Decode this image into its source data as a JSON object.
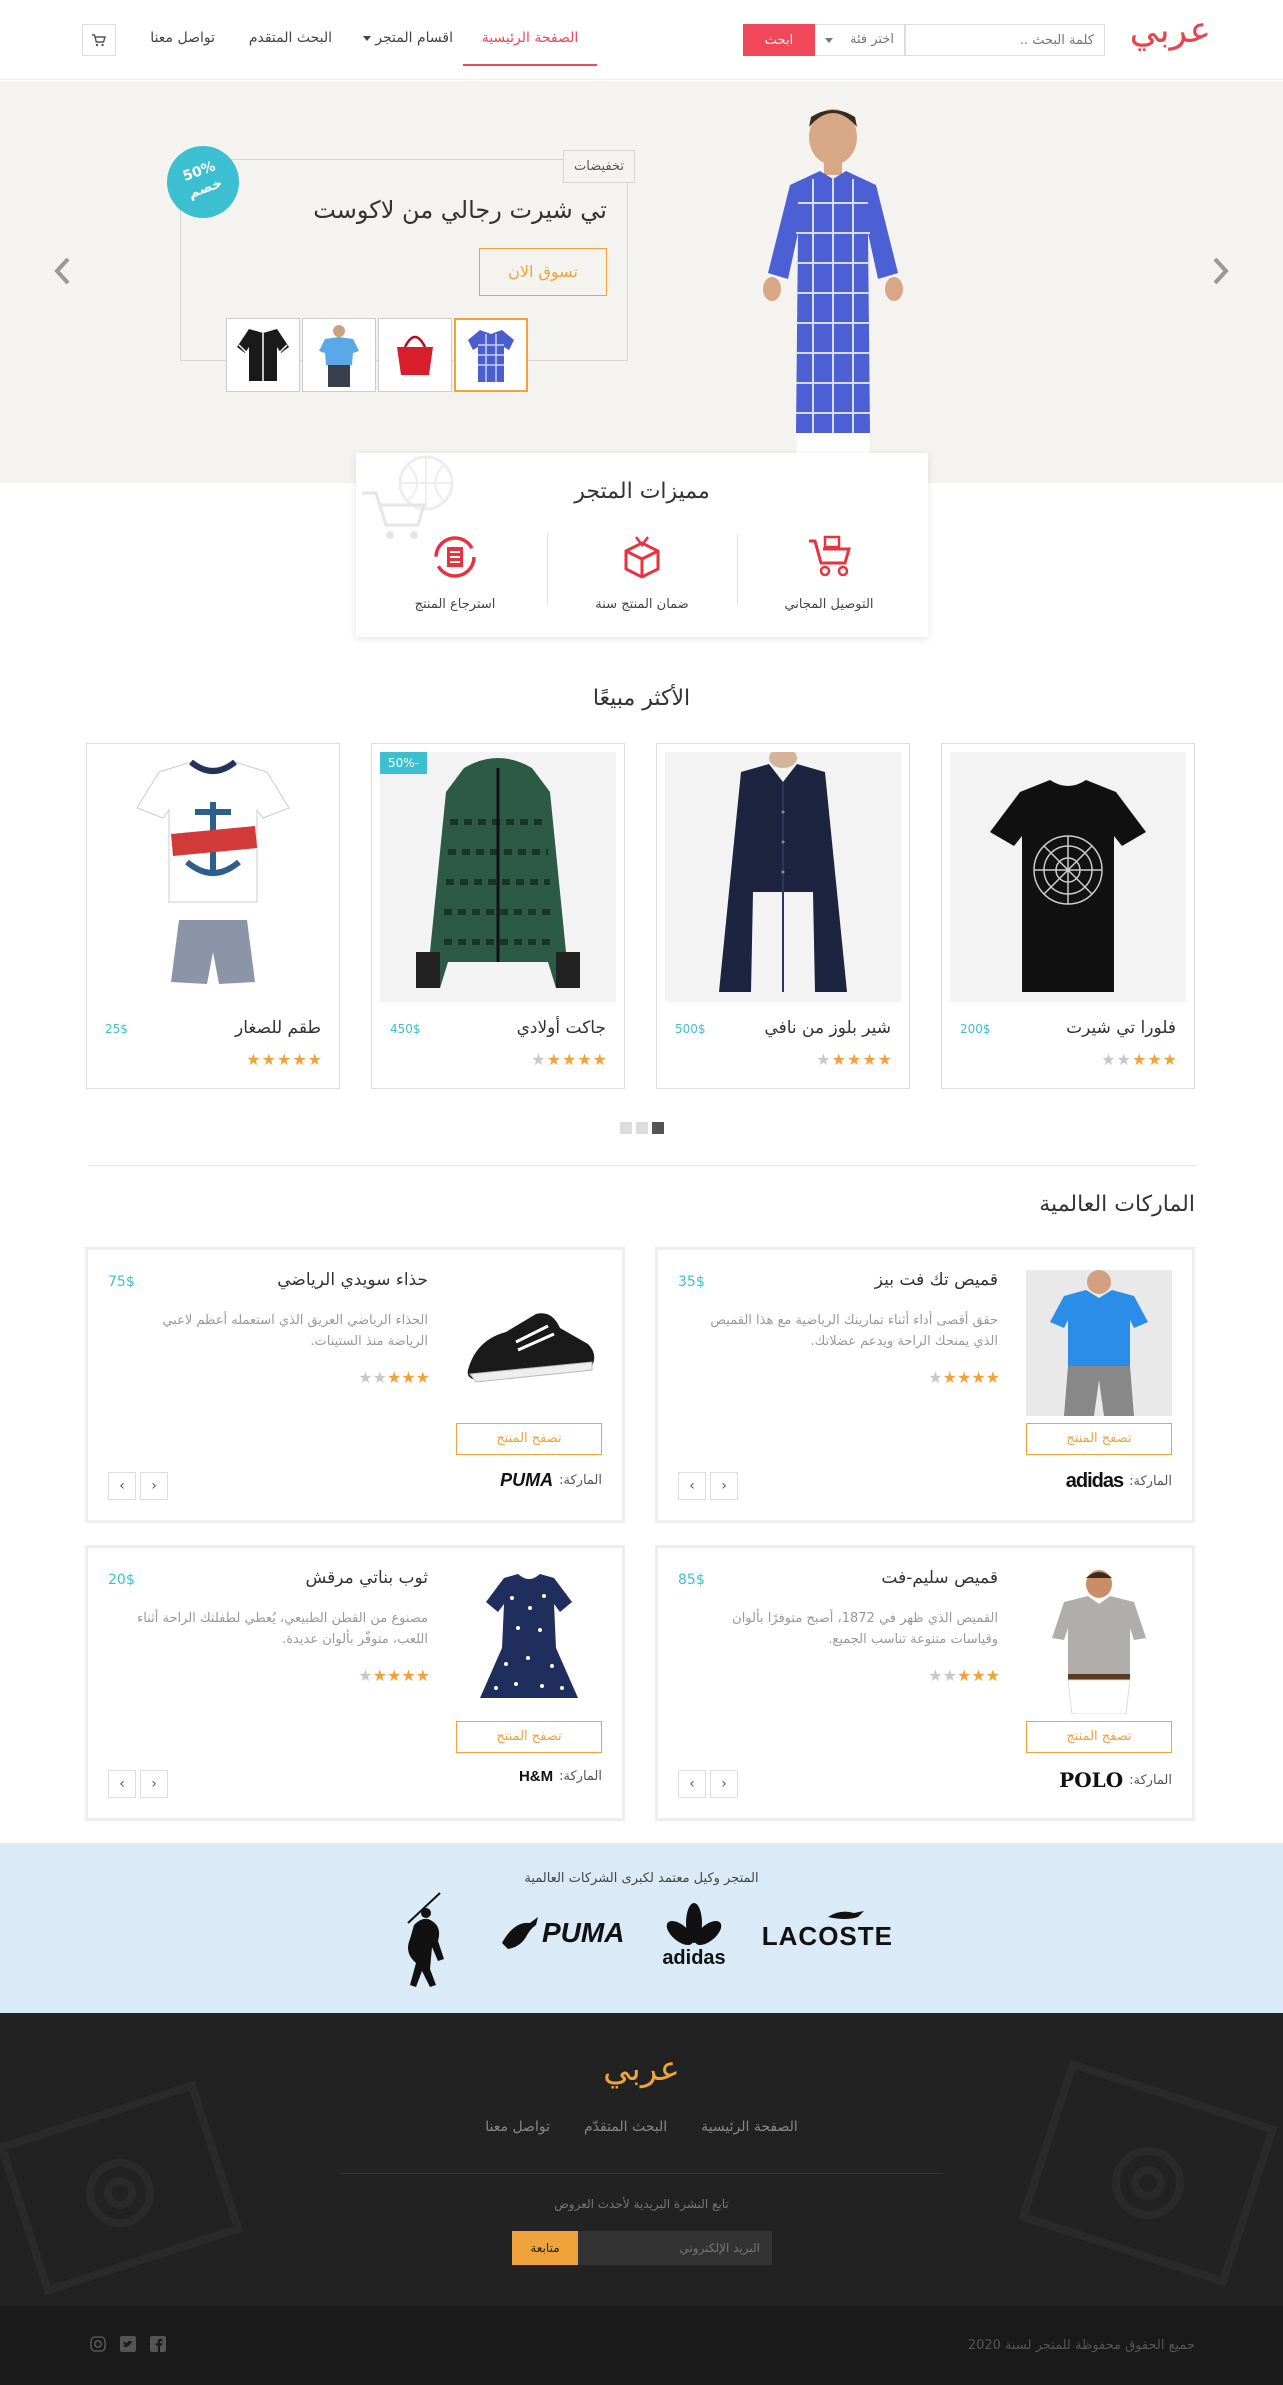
{
  "header": {
    "logo": "عربي",
    "search_placeholder": "كلمة البحث ..",
    "category_select": "اختر فئة",
    "search_button": "ابحث",
    "nav": [
      "الصفحة الرئيسية",
      "اقسام المتجر",
      "البحث المتقدم",
      "تواصل معنا"
    ]
  },
  "hero": {
    "tag": "تخفيضات",
    "badge_line1": "50%",
    "badge_line2": "خصم",
    "title": "تي شيرت رجالي من لاكوست",
    "cta": "تسوق الان"
  },
  "features": {
    "title": "مميزات المتجر",
    "items": [
      "التوصيل المجاني",
      "ضمان المنتج سنة",
      "استرجاع المنتج"
    ]
  },
  "bestsellers": {
    "title": "الأكثر مبيعًا",
    "products": [
      {
        "name": "فلورا تي شيرت",
        "price": "200$",
        "rating": 3
      },
      {
        "name": "شير بلوز من نافي",
        "price": "500$",
        "rating": 4
      },
      {
        "name": "جاكت أولادي",
        "price": "450$",
        "rating": 4,
        "sale": "-50%"
      },
      {
        "name": "طقم للصغار",
        "price": "25$",
        "rating": 5
      }
    ]
  },
  "brands": {
    "title": "الماركات العالمية",
    "view_label": "تصفح المنتج",
    "brand_label": "الماركة:",
    "items": [
      {
        "name": "قميص تك فت بيز",
        "price": "35$",
        "desc": "حقق أقصى أداء أثناء تمارينك الرياضية مع هذا القميص الذي يمنحك الراحة ويدعم عضلاتك.",
        "rating": 4,
        "brand": "adidas"
      },
      {
        "name": "حذاء سويدي الرياضي",
        "price": "75$",
        "desc": "الحذاء الرياضي العريق الذي استعمله أعظم لاعبي الرياضة منذ الستينات.",
        "rating": 3,
        "brand": "PUMA"
      },
      {
        "name": "قميص سليم-فت",
        "price": "85$",
        "desc": "القميص الذي ظهر في 1872، أصبح متوفرًا بألوان وقياسات متنوعة تناسب الجميع.",
        "rating": 3,
        "brand": "POLO"
      },
      {
        "name": "ثوب بناتي مرقش",
        "price": "20$",
        "desc": "مصنوع من القطن الطبيعي، يُعطي لطفلتك الراحة أثناء اللعب، متوفّر بألوان عديدة.",
        "rating": 4,
        "brand": "H&M"
      }
    ]
  },
  "partners": {
    "title": "المتجر وكيل معتمد لكبرى الشركات العالمية",
    "logos": [
      "LACOSTE",
      "adidas",
      "PUMA"
    ]
  },
  "footer": {
    "logo": "عربي",
    "links": [
      "الصفحة الرئيسية",
      "البحث المتقدّم",
      "تواصل معنا"
    ],
    "newsletter": "تابع النشرة البريدية لأحدث العروض",
    "email_placeholder": "البريد الإلكتروني",
    "subscribe": "متابعة",
    "copyright": "جميع الحقوق محفوظة للمتجر لسنة 2020"
  },
  "colors": {
    "accent": "#f04759",
    "orange": "#f0a33b",
    "teal": "#3cc0d1"
  }
}
